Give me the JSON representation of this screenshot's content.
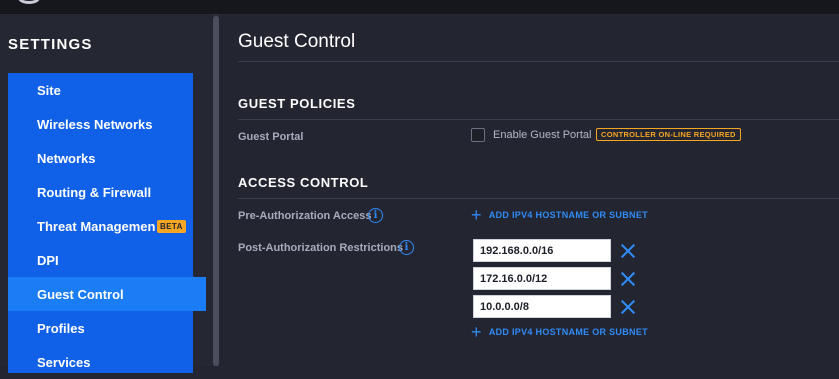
{
  "sidebar": {
    "title": "SETTINGS",
    "items": [
      {
        "label": "Site"
      },
      {
        "label": "Wireless Networks"
      },
      {
        "label": "Networks"
      },
      {
        "label": "Routing & Firewall"
      },
      {
        "label": "Threat Management",
        "badge": "BETA"
      },
      {
        "label": "DPI"
      },
      {
        "label": "Guest Control",
        "active": true
      },
      {
        "label": "Profiles"
      },
      {
        "label": "Services"
      }
    ]
  },
  "main": {
    "title": "Guest Control",
    "guest_policies": {
      "heading": "GUEST POLICIES",
      "guest_portal_label": "Guest Portal",
      "enable_label": "Enable Guest Portal",
      "enable_checked": false,
      "badge": "CONTROLLER ON-LINE REQUIRED"
    },
    "access_control": {
      "heading": "ACCESS CONTROL",
      "pre_auth_label": "Pre-Authorization Access",
      "post_auth_label": "Post-Authorization Restrictions",
      "add_link": "ADD IPV4 HOSTNAME OR SUBNET",
      "restrictions": [
        "192.168.0.0/16",
        "172.16.0.0/12",
        "10.0.0.0/8"
      ]
    }
  },
  "colors": {
    "accent": "#2f8cf7",
    "nav_bg": "#1160e8",
    "nav_active": "#1a7df5",
    "badge": "#f6a623",
    "background": "#232531"
  },
  "icons": {
    "info": "info-icon",
    "add": "plus-icon",
    "remove": "close-icon"
  }
}
